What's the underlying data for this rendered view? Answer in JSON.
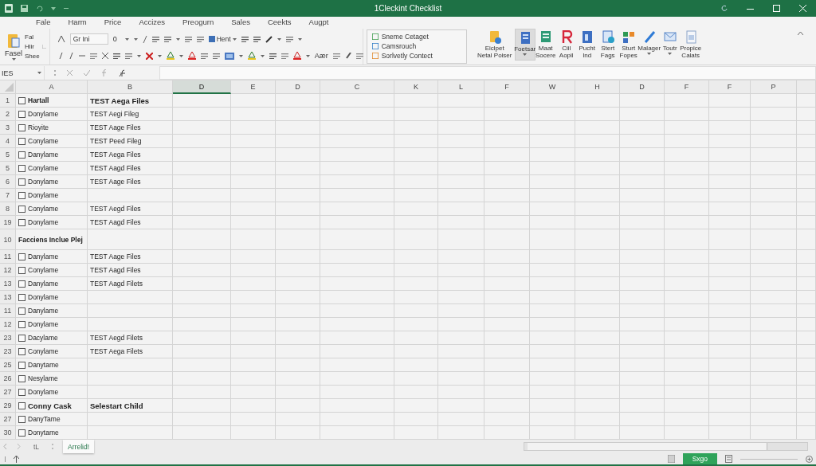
{
  "window": {
    "title": "1Cleckint Checklist"
  },
  "menu_tabs": [
    "Fale",
    "Harm",
    "Price",
    "Accizes",
    "Preogurn",
    "Sales",
    "Ceekts",
    "Augpt"
  ],
  "ribbon": {
    "paste_label": "Fasel",
    "clipboard_items": [
      "Fal",
      "Hlir",
      "Shee"
    ],
    "font_box": "Gr Ini",
    "size_box": "0",
    "wrap_button": "Hent",
    "text_label": "Aær",
    "styles": [
      "Sneme Cetaget",
      "Camsrouch",
      "Sorlvetly Contect"
    ],
    "buttons": [
      {
        "label": "Eiclpet Netal Poiser",
        "selected": false,
        "dropdown": false
      },
      {
        "label": "Foetsar",
        "selected": true,
        "dropdown": true
      },
      {
        "label": "Maat Socere",
        "selected": false,
        "dropdown": false
      },
      {
        "label": "Ciil Aopil",
        "selected": false,
        "dropdown": false
      },
      {
        "label": "Pucht Ind",
        "selected": false,
        "dropdown": false
      },
      {
        "label": "Stert Fags",
        "selected": false,
        "dropdown": false
      },
      {
        "label": "Sturt Fopes",
        "selected": false,
        "dropdown": false
      },
      {
        "label": "Malager",
        "selected": false,
        "dropdown": true
      },
      {
        "label": "Toutr",
        "selected": false,
        "dropdown": true
      },
      {
        "label": "Propice Calats",
        "selected": false,
        "dropdown": false
      }
    ]
  },
  "formula_bar": {
    "name_box": "IES"
  },
  "grid": {
    "columns": [
      {
        "label": "A",
        "selected": false
      },
      {
        "label": "B",
        "selected": false
      },
      {
        "label": "D",
        "selected": true
      },
      {
        "label": "E",
        "selected": false
      },
      {
        "label": "D",
        "selected": false
      },
      {
        "label": "C",
        "selected": false
      },
      {
        "label": "K",
        "selected": false
      },
      {
        "label": "L",
        "selected": false
      },
      {
        "label": "F",
        "selected": false
      },
      {
        "label": "W",
        "selected": false
      },
      {
        "label": "H",
        "selected": false
      },
      {
        "label": "D",
        "selected": false
      },
      {
        "label": "F",
        "selected": false
      },
      {
        "label": "F",
        "selected": false
      },
      {
        "label": "P",
        "selected": false
      }
    ],
    "rows": [
      {
        "number": "1",
        "kind": "checkbox",
        "checked": false,
        "bold": true,
        "column_a": "Hartall",
        "column_b": "TEST Aega Files"
      },
      {
        "number": "2",
        "kind": "checkbox",
        "checked": false,
        "bold": false,
        "column_a": "Donylame",
        "column_b": "TEST Aegi Fileg"
      },
      {
        "number": "3",
        "kind": "checkbox",
        "checked": false,
        "bold": false,
        "column_a": "Rioyite",
        "column_b": "TEST Aage Files"
      },
      {
        "number": "4",
        "kind": "checkbox",
        "checked": false,
        "bold": false,
        "column_a": "Conylame",
        "column_b": "TEST Peed Fileg"
      },
      {
        "number": "5",
        "kind": "checkbox",
        "checked": false,
        "bold": false,
        "column_a": "Danylame",
        "column_b": "TEST Aega Files"
      },
      {
        "number": "5",
        "kind": "checkbox",
        "checked": false,
        "bold": false,
        "column_a": "Conylame",
        "column_b": "TEST Aagd Files"
      },
      {
        "number": "6",
        "kind": "checkbox",
        "checked": false,
        "bold": false,
        "column_a": "Donylame",
        "column_b": "TEST Aage Files"
      },
      {
        "number": "7",
        "kind": "checkbox",
        "checked": false,
        "bold": false,
        "column_a": "Donylame"
      },
      {
        "number": "8",
        "kind": "checkbox",
        "checked": false,
        "bold": false,
        "column_a": "Conylame",
        "column_b": "TEST Aegd Files"
      },
      {
        "number": "19",
        "kind": "checkbox",
        "checked": false,
        "bold": false,
        "column_a": "Donylame",
        "column_b": "TEST Aagd Files"
      },
      {
        "number": "10",
        "kind": "heading",
        "bold": true,
        "column_a": "Facciens Inclue Plej"
      },
      {
        "number": "11",
        "kind": "checkbox",
        "checked": false,
        "bold": false,
        "column_a": "Danylame",
        "column_b": "TEST Aage Files"
      },
      {
        "number": "12",
        "kind": "checkbox",
        "checked": false,
        "bold": false,
        "column_a": "Conylame",
        "column_b": "TEST Aagd Files"
      },
      {
        "number": "13",
        "kind": "checkbox",
        "checked": false,
        "bold": false,
        "column_a": "Danylame",
        "column_b": "TEST Aagd Filets"
      },
      {
        "number": "13",
        "kind": "checkbox",
        "checked": false,
        "bold": false,
        "column_a": "Donylame"
      },
      {
        "number": "11",
        "kind": "checkbox",
        "checked": false,
        "bold": false,
        "column_a": "Danylame"
      },
      {
        "number": "12",
        "kind": "checkbox",
        "checked": false,
        "bold": false,
        "column_a": "Donylame"
      },
      {
        "number": "23",
        "kind": "checkbox",
        "checked": false,
        "bold": false,
        "column_a": "Dacylame",
        "column_b": "TEST Aegd Filets"
      },
      {
        "number": "23",
        "kind": "checkbox",
        "checked": false,
        "bold": false,
        "column_a": "Conylame",
        "column_b": "TEST Aega Filets"
      },
      {
        "number": "25",
        "kind": "checkbox",
        "checked": false,
        "bold": false,
        "column_a": "Danytame"
      },
      {
        "number": "26",
        "kind": "checkbox",
        "checked": false,
        "bold": false,
        "column_a": "Nesylame"
      },
      {
        "number": "27",
        "kind": "checkbox",
        "checked": false,
        "bold": false,
        "column_a": "Donylame"
      },
      {
        "number": "29",
        "kind": "checkbox",
        "checked": false,
        "bold": true,
        "column_a": "Conny Cask",
        "column_b": "Selestart Child"
      },
      {
        "number": "27",
        "kind": "checkbox",
        "checked": false,
        "bold": false,
        "column_a": "DanyTame"
      },
      {
        "number": "30",
        "kind": "checkbox",
        "checked": false,
        "bold": false,
        "column_a": "Donytame"
      }
    ]
  },
  "sheet_tabs": [
    {
      "label": "tL",
      "selected": false
    },
    {
      "label": "Arrelid!",
      "selected": true
    }
  ],
  "status_bar": {
    "view_button": "Sxgo"
  }
}
